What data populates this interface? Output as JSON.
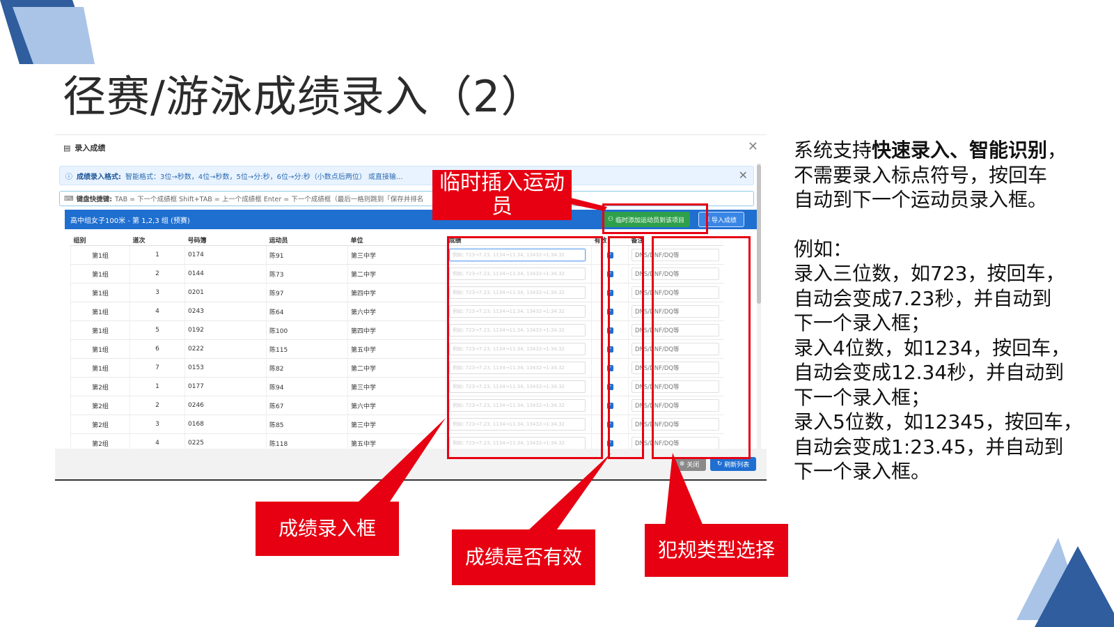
{
  "slide": {
    "title": "径赛/游泳成绩录入（2）"
  },
  "dialog": {
    "title": "录入成绩",
    "info_label": "成绩录入格式:",
    "info_text": "智能格式：3位→秒数，4位→秒数，5位→分:秒，6位→分:秒（小数点后两位） 或直接输...",
    "kbd_label": "键盘快捷键:",
    "kbd_text": "TAB = 下一个成绩框   Shift+TAB = 上一个成绩框   Enter = 下一个成绩框（最后一格则跳到「保存并排名",
    "event_title": "高中组女子100米 - 第 1,2,3 组 (预赛)",
    "add_athlete_button": "临时添加运动员到该项目",
    "import_button": "导入成绩",
    "close_button": "关闭",
    "refresh_button": "刷新列表",
    "columns": [
      "组别",
      "道次",
      "号码簿",
      "运动员",
      "单位",
      "成绩",
      "有效",
      "备注"
    ],
    "score_placeholder": "例如: 723→7.23, 1134→11.34, 13432→1:34.32",
    "note_placeholder": "DNS/DNF/DQ等",
    "rows": [
      {
        "group": "第1组",
        "lane": "1",
        "bib": "0174",
        "name": "陈91",
        "unit": "第三中学"
      },
      {
        "group": "第1组",
        "lane": "2",
        "bib": "0144",
        "name": "陈73",
        "unit": "第二中学"
      },
      {
        "group": "第1组",
        "lane": "3",
        "bib": "0201",
        "name": "陈97",
        "unit": "第四中学"
      },
      {
        "group": "第1组",
        "lane": "4",
        "bib": "0243",
        "name": "陈64",
        "unit": "第六中学"
      },
      {
        "group": "第1组",
        "lane": "5",
        "bib": "0192",
        "name": "陈100",
        "unit": "第四中学"
      },
      {
        "group": "第1组",
        "lane": "6",
        "bib": "0222",
        "name": "陈115",
        "unit": "第五中学"
      },
      {
        "group": "第1组",
        "lane": "7",
        "bib": "0153",
        "name": "陈82",
        "unit": "第二中学"
      },
      {
        "group": "第2组",
        "lane": "1",
        "bib": "0177",
        "name": "陈94",
        "unit": "第三中学"
      },
      {
        "group": "第2组",
        "lane": "2",
        "bib": "0246",
        "name": "陈67",
        "unit": "第六中学"
      },
      {
        "group": "第2组",
        "lane": "3",
        "bib": "0168",
        "name": "陈85",
        "unit": "第三中学"
      },
      {
        "group": "第2组",
        "lane": "4",
        "bib": "0225",
        "name": "陈118",
        "unit": "第五中学"
      }
    ]
  },
  "annotations": {
    "insert_athlete": "临时插入运动员",
    "score_box": "成绩录入框",
    "valid": "成绩是否有效",
    "foul_type": "犯规类型选择"
  },
  "description": {
    "line1_a": "系统支持",
    "line1_b": "快速录入、智能识别",
    "line1_c": "，",
    "line2": "不需要录入标点符号，按回车",
    "line3": "自动到下一个运动员录入框。",
    "example": "例如：",
    "e1": "录入三位数，如723，按回车，",
    "e2": "自动会变成7.23秒，并自动到",
    "e3": "下一个录入框；",
    "e4": "录入4位数，如1234，按回车，",
    "e5": "自动会变成12.34秒，并自动到",
    "e6": "下一个录入框；",
    "e7": "录入5位数，如12345，按回车，",
    "e8": "自动会变成1:23.45，并自动到",
    "e9": "下一个录入框。"
  },
  "colors": {
    "accent_red": "#e60012",
    "blue": "#1f6fd1",
    "green": "#2e9f4a"
  }
}
